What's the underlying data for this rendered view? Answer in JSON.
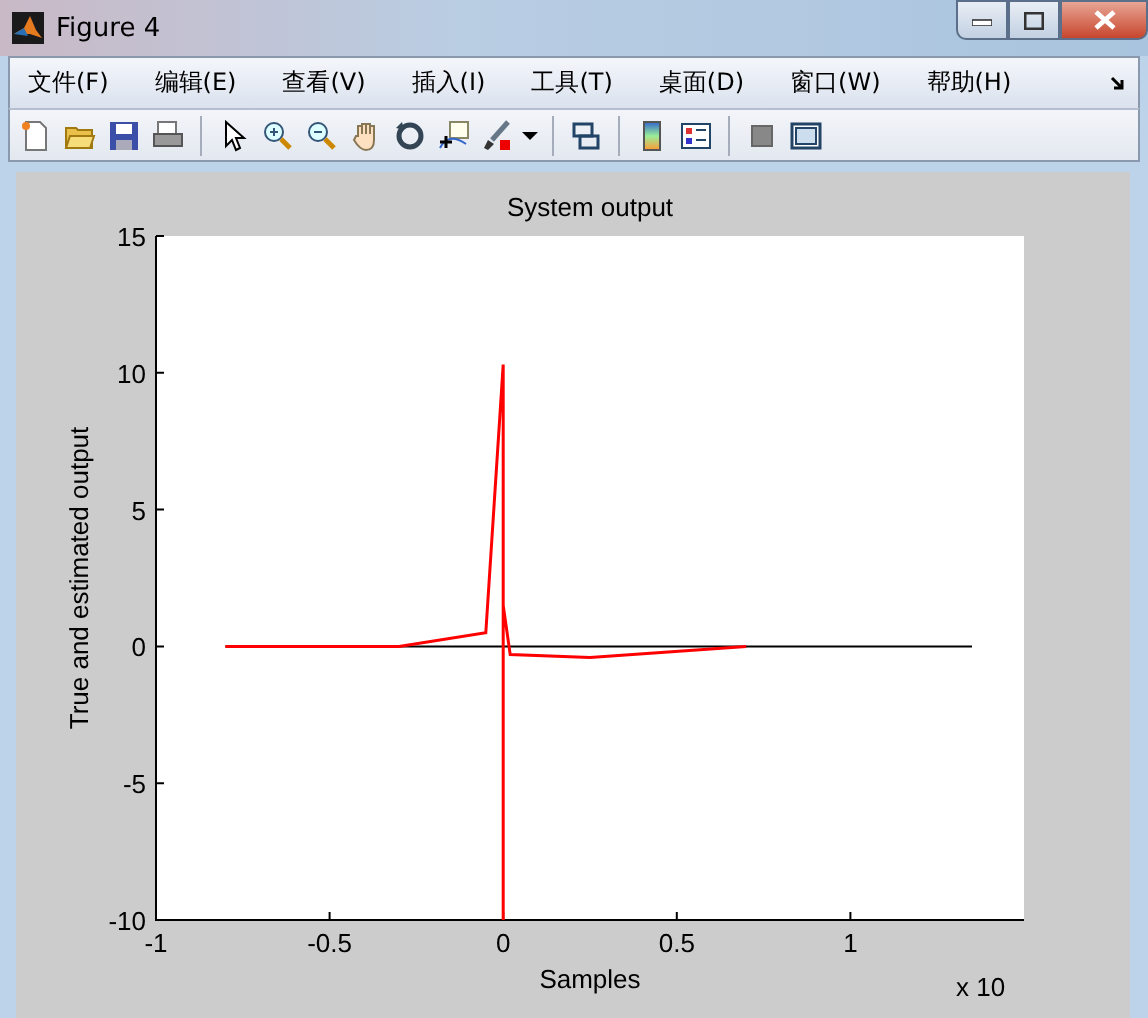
{
  "window": {
    "title": "Figure 4"
  },
  "menu": [
    {
      "label": "文件(F)"
    },
    {
      "label": "编辑(E)"
    },
    {
      "label": "查看(V)"
    },
    {
      "label": "插入(I)"
    },
    {
      "label": "工具(T)"
    },
    {
      "label": "桌面(D)"
    },
    {
      "label": "窗口(W)"
    },
    {
      "label": "帮助(H)"
    }
  ],
  "plot": {
    "exponent_label": "x 10",
    "chart_data": {
      "type": "line",
      "title": "System output",
      "xlabel": "Samples",
      "ylabel": "True and estimated output",
      "x": [
        -0.8,
        -0.3,
        -0.05,
        0,
        0,
        0,
        0.02,
        0.25,
        0.7,
        1.35
      ],
      "series": [
        {
          "color": "#ff0000",
          "values": [
            0,
            0,
            0.5,
            10.3,
            -10,
            1.5,
            -0.3,
            -0.4,
            0,
            null
          ]
        },
        {
          "color": "#000000",
          "values": [
            0,
            0,
            0,
            0,
            0,
            0,
            0,
            0,
            0,
            0
          ]
        }
      ],
      "xlim": [
        -1,
        1.5
      ],
      "ylim": [
        -10,
        15
      ],
      "xticks": [
        -1,
        -0.5,
        0,
        0.5,
        1
      ],
      "yticks": [
        -10,
        -5,
        0,
        5,
        10,
        15
      ]
    }
  }
}
